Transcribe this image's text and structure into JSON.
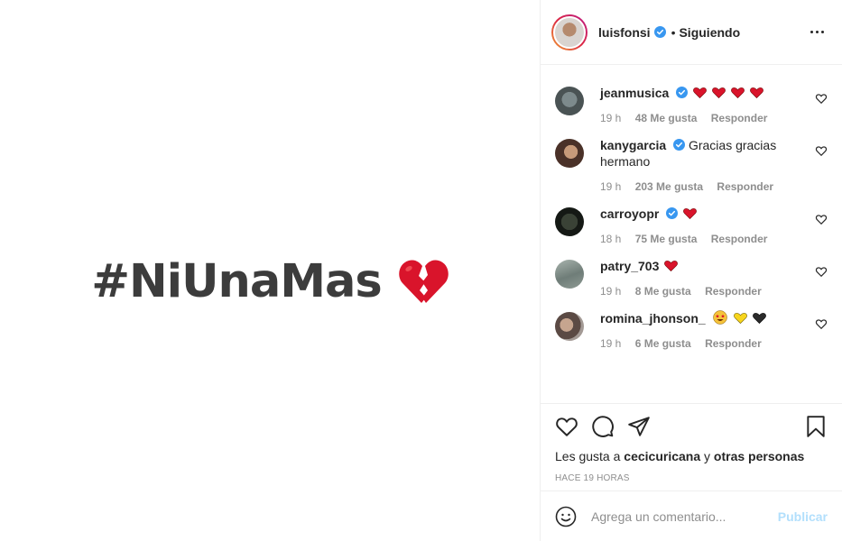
{
  "media": {
    "hashtag": "#NiUnaMas",
    "emoji": "broken-heart-icon"
  },
  "header": {
    "username": "luisfonsi",
    "separator": "•",
    "follow_status": "Siguiendo"
  },
  "comments": [
    {
      "user": "jeanmusica",
      "verified": true,
      "text": "",
      "emojis": [
        "red-heart",
        "red-heart",
        "red-heart",
        "red-heart"
      ],
      "time": "19 h",
      "likes": "48 Me gusta",
      "reply": "Responder"
    },
    {
      "user": "kanygarcia",
      "verified": true,
      "text": "Gracias gracias hermano",
      "emojis": [],
      "time": "19 h",
      "likes": "203 Me gusta",
      "reply": "Responder"
    },
    {
      "user": "carroyopr",
      "verified": true,
      "text": "",
      "emojis": [
        "red-heart"
      ],
      "time": "18 h",
      "likes": "75 Me gusta",
      "reply": "Responder"
    },
    {
      "user": "patry_703",
      "verified": false,
      "text": "",
      "emojis": [
        "red-heart"
      ],
      "time": "19 h",
      "likes": "8 Me gusta",
      "reply": "Responder"
    },
    {
      "user": "romina_jhonson_",
      "verified": false,
      "text": "",
      "emojis": [
        "star-struck",
        "yellow-heart",
        "black-heart"
      ],
      "time": "19 h",
      "likes": "6 Me gusta",
      "reply": "Responder"
    }
  ],
  "likes_line": {
    "prefix": "Les gusta a",
    "user": "cecicuricana",
    "middle": "y",
    "others": "otras personas"
  },
  "time_ago": "HACE 19 HORAS",
  "add_comment": {
    "placeholder": "Agrega un comentario...",
    "publish": "Publicar"
  },
  "colors": {
    "verified": "#3897f0",
    "publish_disabled": "#b2dffc",
    "meta": "#8e8e8e",
    "heart_red": "#d9142b"
  }
}
